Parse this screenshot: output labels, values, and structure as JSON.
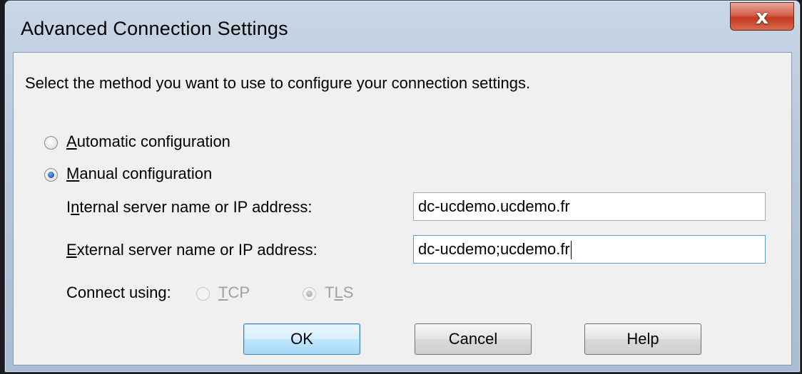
{
  "window": {
    "title": "Advanced Connection Settings",
    "close_glyph": "x"
  },
  "dialog": {
    "intro": "Select the method you want to use to configure your connection settings.",
    "automatic": {
      "label_first": "A",
      "label_rest": "utomatic configuration",
      "checked": false
    },
    "manual": {
      "label_first": "M",
      "label_rest": "anual configuration",
      "checked": true
    },
    "internal": {
      "label_pre": "I",
      "label_u": "n",
      "label_post": "ternal server name or IP address:",
      "value": "dc-ucdemo.ucdemo.fr"
    },
    "external": {
      "label_u": "E",
      "label_post": "xternal server name or IP address:",
      "value": "dc-ucdemo;ucdemo.fr"
    },
    "connect_using": {
      "label": "Connect using:",
      "tcp": {
        "label_u": "T",
        "label_post": "CP",
        "checked": false,
        "enabled": false
      },
      "tls": {
        "label_pre": "T",
        "label_u": "L",
        "label_post": "S",
        "checked": true,
        "enabled": false
      }
    }
  },
  "buttons": {
    "ok": "OK",
    "cancel": "Cancel",
    "help": "Help"
  }
}
